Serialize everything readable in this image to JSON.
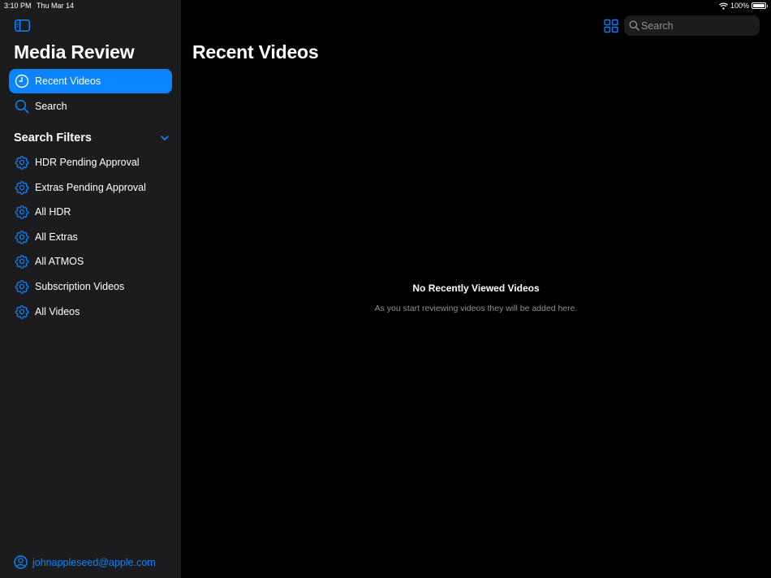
{
  "status_bar": {
    "time": "3:10 PM",
    "date": "Thu Mar 14",
    "battery_text": "100%",
    "battery_level": 1.0,
    "icons": [
      "wifi-icon",
      "battery-icon"
    ]
  },
  "colors": {
    "accent": "#0a84ff",
    "sidebar_bg": "#1c1c1e",
    "main_bg": "#000000",
    "secondary_text": "#8e8e93"
  },
  "sidebar": {
    "toggle_icon": "sidebar-toggle-icon",
    "app_title": "Media Review",
    "nav": [
      {
        "label": "Recent Videos",
        "icon": "clock-icon",
        "selected": true
      },
      {
        "label": "Search",
        "icon": "search-icon",
        "selected": false
      }
    ],
    "filters_section": {
      "title": "Search Filters",
      "expanded": true,
      "items": [
        {
          "label": "HDR Pending Approval",
          "icon": "gear-icon"
        },
        {
          "label": "Extras Pending Approval",
          "icon": "gear-icon"
        },
        {
          "label": "All HDR",
          "icon": "gear-icon"
        },
        {
          "label": "All Extras",
          "icon": "gear-icon"
        },
        {
          "label": "All ATMOS",
          "icon": "gear-icon"
        },
        {
          "label": "Subscription Videos",
          "icon": "gear-icon"
        },
        {
          "label": "All Videos",
          "icon": "gear-icon"
        }
      ]
    },
    "account": {
      "email": "johnappleseed@apple.com",
      "icon": "person-circle-icon"
    }
  },
  "main": {
    "title": "Recent Videos",
    "toolbar": {
      "grid_icon": "grid-icon",
      "search_placeholder": "Search",
      "search_value": ""
    },
    "empty_state": {
      "title": "No Recently Viewed Videos",
      "message": "As you start reviewing videos they will be added here."
    }
  }
}
